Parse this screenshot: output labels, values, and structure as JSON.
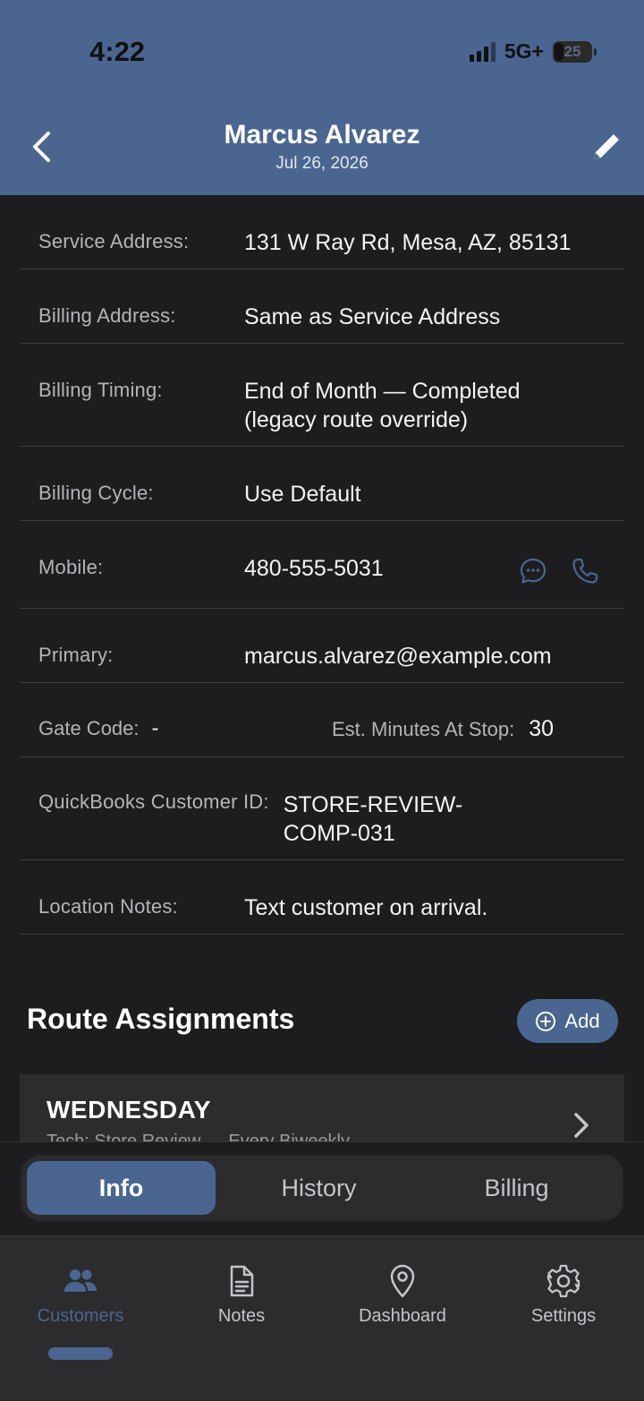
{
  "status_bar": {
    "time": "4:22",
    "network": "5G+",
    "battery": "25"
  },
  "header": {
    "title": "Marcus Alvarez",
    "subtitle": "Jul 26, 2026"
  },
  "info": {
    "service_address_label": "Service Address:",
    "service_address_value": "131 W Ray Rd, Mesa, AZ, 85131",
    "billing_address_label": "Billing Address:",
    "billing_address_value": "Same as Service Address",
    "billing_timing_label": "Billing Timing:",
    "billing_timing_line1": "End of Month — Completed",
    "billing_timing_line2": "(legacy route override)",
    "billing_cycle_label": "Billing Cycle:",
    "billing_cycle_value": "Use Default",
    "mobile_label": "Mobile:",
    "mobile_value": "480-555-5031",
    "primary_label": "Primary:",
    "primary_value": "marcus.alvarez@example.com",
    "gate_code_label": "Gate Code:",
    "gate_code_value": "-",
    "est_minutes_label": "Est. Minutes At Stop:",
    "est_minutes_value": "30",
    "quickbooks_label": "QuickBooks Customer ID:",
    "quickbooks_line1": "STORE-REVIEW-",
    "quickbooks_line2": "COMP-031",
    "location_notes_label": "Location Notes:",
    "location_notes_value": "Text customer on arrival."
  },
  "route_assignments": {
    "title": "Route Assignments",
    "add_label": "Add",
    "card_day": "WEDNESDAY",
    "card_sub": "Tech: Store Review — Every Biweekly"
  },
  "segments": {
    "tabs": [
      "Info",
      "History",
      "Billing"
    ],
    "active": "Info"
  },
  "bottom_nav": {
    "items": [
      "Customers",
      "Notes",
      "Dashboard",
      "Settings"
    ],
    "active": "Customers"
  },
  "colors": {
    "accent": "#4a6690",
    "background": "#1d1d1f",
    "card": "#2c2c2f"
  }
}
